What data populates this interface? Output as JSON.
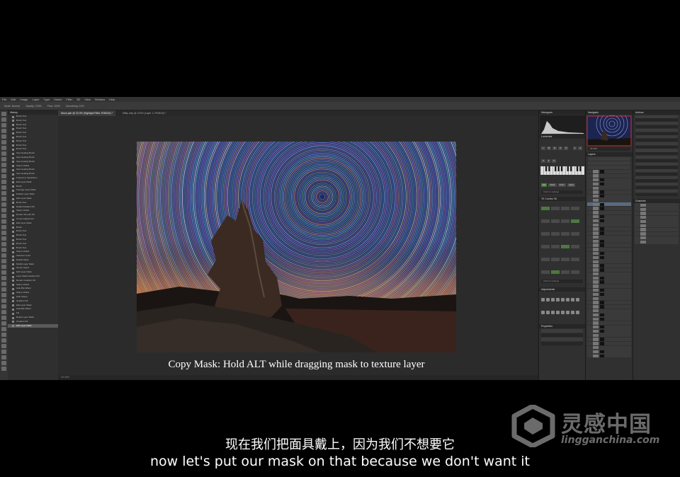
{
  "menu": [
    "File",
    "Edit",
    "Image",
    "Layer",
    "Type",
    "Select",
    "Filter",
    "3D",
    "View",
    "Window",
    "Help"
  ],
  "options_bar": [
    "Mode: Normal",
    "Opacity: 100%",
    "Flow: 100%",
    "Smoothing: 10%"
  ],
  "history": {
    "tab": "History",
    "items": [
      "Brush Tool",
      "Brush Tool",
      "Brush Tool",
      "Brush Tool",
      "Brush Tool",
      "Brush Tool",
      "Brush Tool",
      "Brush Tool",
      "Brush Tool",
      "Spot Healing Brush",
      "Spot Healing Brush",
      "Spot Healing Brush",
      "Stamp Visible",
      "Spot Healing Brush",
      "Spot Healing Brush",
      "Frequency Separation",
      "Edit Layer Mask",
      "Brush",
      "Smudge Layer Mask",
      "Enable Layer Mask",
      "Edit Layer Mask",
      "Brush Tool",
      "Radial Gradient Fill",
      "Stamp Visible",
      "Render Smooth Fill",
      "Curves Adjustment",
      "Edit Layer Mask",
      "Brush",
      "Brush Tool",
      "Brush Tool",
      "Brush Tool",
      "Brush Tool",
      "Brush Tool",
      "Stamp Visible",
      "Selective Color",
      "Enable Mask",
      "Modify Layer Mask",
      "Group Layers",
      "Edit Layer Mask",
      "Layer Mask Gradient Fill",
      "Render Gradient Fill",
      "Stamp Visible",
      "Hide Blur Effect",
      "Stamp Visible",
      "Hide Stamp",
      "Gradient Fill",
      "Edit Layer Mask",
      "Hide Blur Effect",
      "Fill",
      "Delete Layer Mask",
      "Gradient Fill",
      "Edit Layer Mask"
    ],
    "active_index": 51
  },
  "doc_tabs": [
    {
      "label": "Moon.psb @ 33.3% (Highlight Filter, RGB/16) *",
      "active": true
    },
    {
      "label": "Milky way @ 100% (Layer 1, RGB/16) *",
      "active": false
    }
  ],
  "status": "33.33%",
  "caption": "Copy Mask: Hold ALT while dragging mask to texture layer",
  "panels": {
    "histogram": "Histogram",
    "navigator": "Navigator",
    "actions": "Actions",
    "layers": "Layers",
    "channels": "Channels",
    "adjustments": "Adjustments",
    "properties": "Properties",
    "lumenzia": "Lumenzia",
    "tk": "TK Combo V6",
    "click_settings": "Click for settings",
    "zoom": "33.33%"
  },
  "subtitle_cn": "现在我们把面具戴上，因为我们不想要它",
  "subtitle_en": "now let's put our mask on that because we don't want it",
  "watermark": {
    "name": "灵感中国",
    "url": "lingganchina.com"
  },
  "colors": {
    "accent": "#4b7a3f",
    "selection": "#5a6a80"
  }
}
